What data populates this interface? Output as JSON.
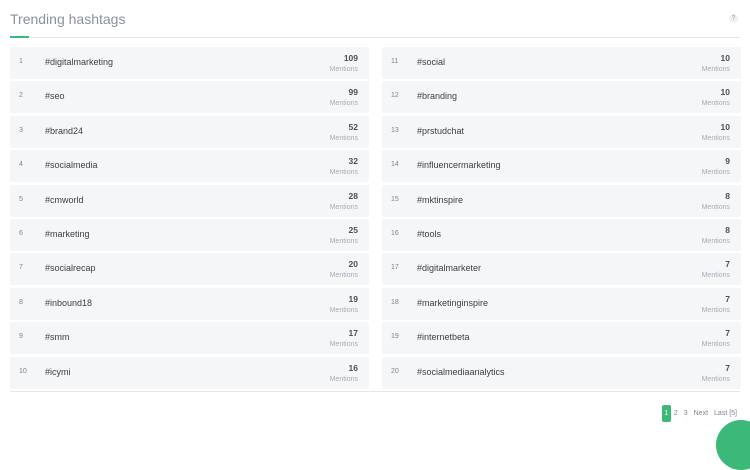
{
  "header": {
    "title": "Trending hashtags",
    "help": "?"
  },
  "mentions_label": "Mentions",
  "left": [
    {
      "rank": "1",
      "tag": "#digitalmarketing",
      "count": "109"
    },
    {
      "rank": "2",
      "tag": "#seo",
      "count": "99"
    },
    {
      "rank": "3",
      "tag": "#brand24",
      "count": "52"
    },
    {
      "rank": "4",
      "tag": "#socialmedia",
      "count": "32"
    },
    {
      "rank": "5",
      "tag": "#cmworld",
      "count": "28"
    },
    {
      "rank": "6",
      "tag": "#marketing",
      "count": "25"
    },
    {
      "rank": "7",
      "tag": "#socialrecap",
      "count": "20"
    },
    {
      "rank": "8",
      "tag": "#inbound18",
      "count": "19"
    },
    {
      "rank": "9",
      "tag": "#smm",
      "count": "17"
    },
    {
      "rank": "10",
      "tag": "#icymi",
      "count": "16"
    }
  ],
  "right": [
    {
      "rank": "11",
      "tag": "#social",
      "count": "10"
    },
    {
      "rank": "12",
      "tag": "#branding",
      "count": "10"
    },
    {
      "rank": "13",
      "tag": "#prstudchat",
      "count": "10"
    },
    {
      "rank": "14",
      "tag": "#influencermarketing",
      "count": "9"
    },
    {
      "rank": "15",
      "tag": "#mktinspire",
      "count": "8"
    },
    {
      "rank": "16",
      "tag": "#tools",
      "count": "8"
    },
    {
      "rank": "17",
      "tag": "#digitalmarketer",
      "count": "7"
    },
    {
      "rank": "18",
      "tag": "#marketinginspire",
      "count": "7"
    },
    {
      "rank": "19",
      "tag": "#internetbeta",
      "count": "7"
    },
    {
      "rank": "20",
      "tag": "#socialmediaanalytics",
      "count": "7"
    }
  ],
  "pagination": {
    "pages": [
      "1",
      "2",
      "3"
    ],
    "current": "1",
    "next": "Next",
    "last": "Last [5]"
  },
  "colors": {
    "accent": "#3cb878",
    "row_bg": "#f5f6f7"
  }
}
